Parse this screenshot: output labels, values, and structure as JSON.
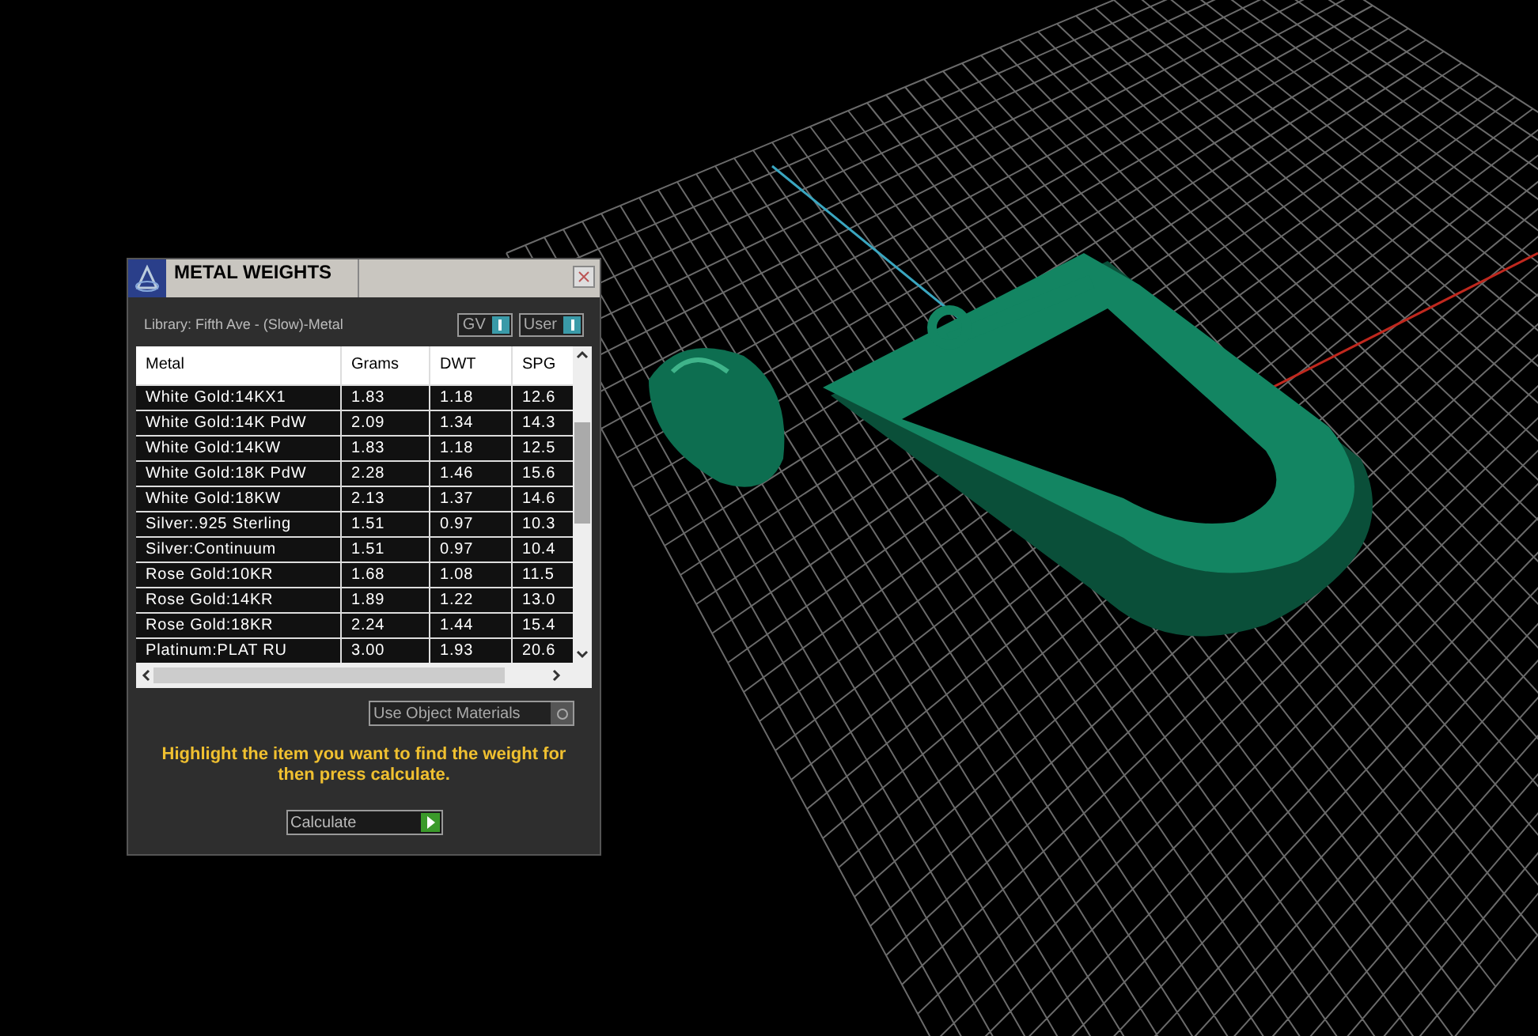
{
  "window": {
    "title": "METAL WEIGHTS"
  },
  "library": "Library: Fifth Ave - (Slow)-Metal",
  "toggles": [
    {
      "label": "GV",
      "on": true
    },
    {
      "label": "User",
      "on": true
    }
  ],
  "table": {
    "columns": [
      "Metal",
      "Grams",
      "DWT",
      "SPG"
    ],
    "rows": [
      [
        "White Gold:14KX1",
        "1.83",
        "1.18",
        "12.6"
      ],
      [
        "White Gold:14K PdW",
        "2.09",
        "1.34",
        "14.3"
      ],
      [
        "White Gold:14KW",
        "1.83",
        "1.18",
        "12.5"
      ],
      [
        "White Gold:18K PdW",
        "2.28",
        "1.46",
        "15.6"
      ],
      [
        "White Gold:18KW",
        "2.13",
        "1.37",
        "14.6"
      ],
      [
        "Silver:.925 Sterling",
        "1.51",
        "0.97",
        "10.3"
      ],
      [
        "Silver:Continuum",
        "1.51",
        "0.97",
        "10.4"
      ],
      [
        "Rose Gold:10KR",
        "1.68",
        "1.08",
        "11.5"
      ],
      [
        "Rose Gold:14KR",
        "1.89",
        "1.22",
        "13.0"
      ],
      [
        "Rose Gold:18KR",
        "2.24",
        "1.44",
        "15.4"
      ],
      [
        "Platinum:PLAT RU",
        "3.00",
        "1.93",
        "20.6"
      ]
    ]
  },
  "object_materials": {
    "label": "Use Object Materials",
    "on": false
  },
  "hint": "Highlight the item you want to find the weight for then press calculate.",
  "calculate": "Calculate"
}
